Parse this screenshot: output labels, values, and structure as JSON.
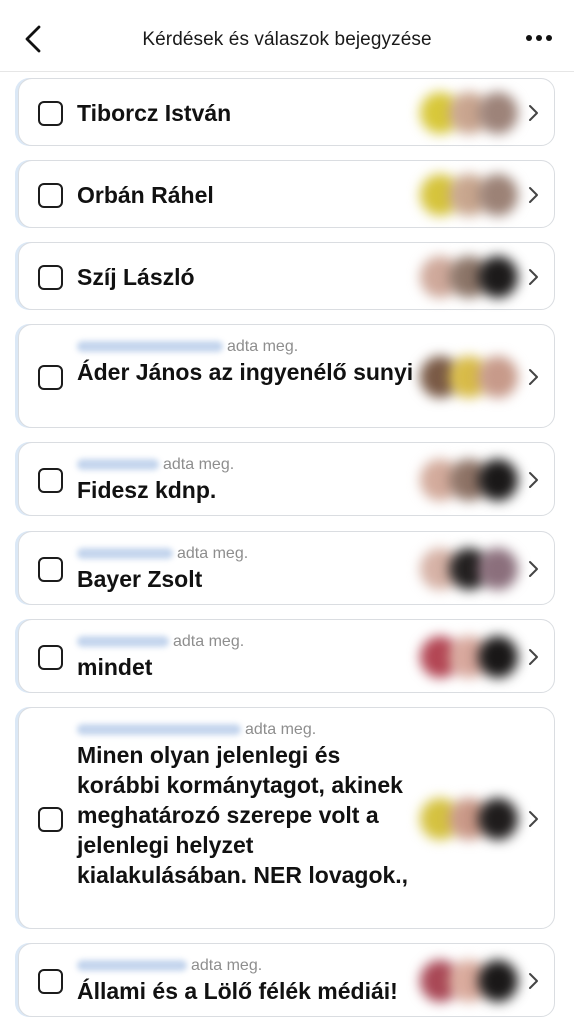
{
  "header": {
    "title": "Kérdések és válaszok bejegyzése",
    "back_icon": "chevron-left-icon",
    "more_icon": "more-horizontal-icon"
  },
  "answers": [
    {
      "text": "Tiborcz István",
      "submitted_by_suffix": "",
      "avatar_colors": [
        "#d8c83a",
        "#c9a58f",
        "#9d8379"
      ]
    },
    {
      "text": "Orbán Ráhel",
      "submitted_by_suffix": "",
      "avatar_colors": [
        "#d6c43c",
        "#c8a68e",
        "#9c8276"
      ]
    },
    {
      "text": "Szíj László",
      "submitted_by_suffix": "",
      "avatar_colors": [
        "#cfa99b",
        "#8c7568",
        "#1c1a1a"
      ]
    },
    {
      "text": "Áder János az ingyenélő sunyi",
      "submitted_by_suffix": "adta meg.",
      "avatar_colors": [
        "#7a5a46",
        "#d8bb48",
        "#c79a8a"
      ]
    },
    {
      "text": "Fidesz kdnp.",
      "submitted_by_suffix": "adta meg.",
      "avatar_colors": [
        "#d3ab9c",
        "#8e7366",
        "#1a1818"
      ]
    },
    {
      "text": "Bayer Zsolt",
      "submitted_by_suffix": "adta meg.",
      "avatar_colors": [
        "#d6b2a6",
        "#232020",
        "#8b6f7c"
      ]
    },
    {
      "text": "mindet",
      "submitted_by_suffix": "adta meg.",
      "avatar_colors": [
        "#b34654",
        "#d7a79c",
        "#191717"
      ]
    },
    {
      "text": "Minen olyan jelenlegi és korábbi kormánytagot, akinek meghatározó szerepe volt a jelenlegi helyzet kialakulásában. NER lovagok.,",
      "submitted_by_suffix": "adta meg.",
      "avatar_colors": [
        "#d5c240",
        "#c99887",
        "#1f1c1c"
      ]
    },
    {
      "text": "Állami és a Lölő félék médiái!",
      "submitted_by_suffix": "adta meg.",
      "avatar_colors": [
        "#a94856",
        "#d9aa9c",
        "#1a1818"
      ]
    }
  ],
  "checkbox_icon": "checkbox-empty-icon",
  "chevron_icon": "chevron-right-icon"
}
